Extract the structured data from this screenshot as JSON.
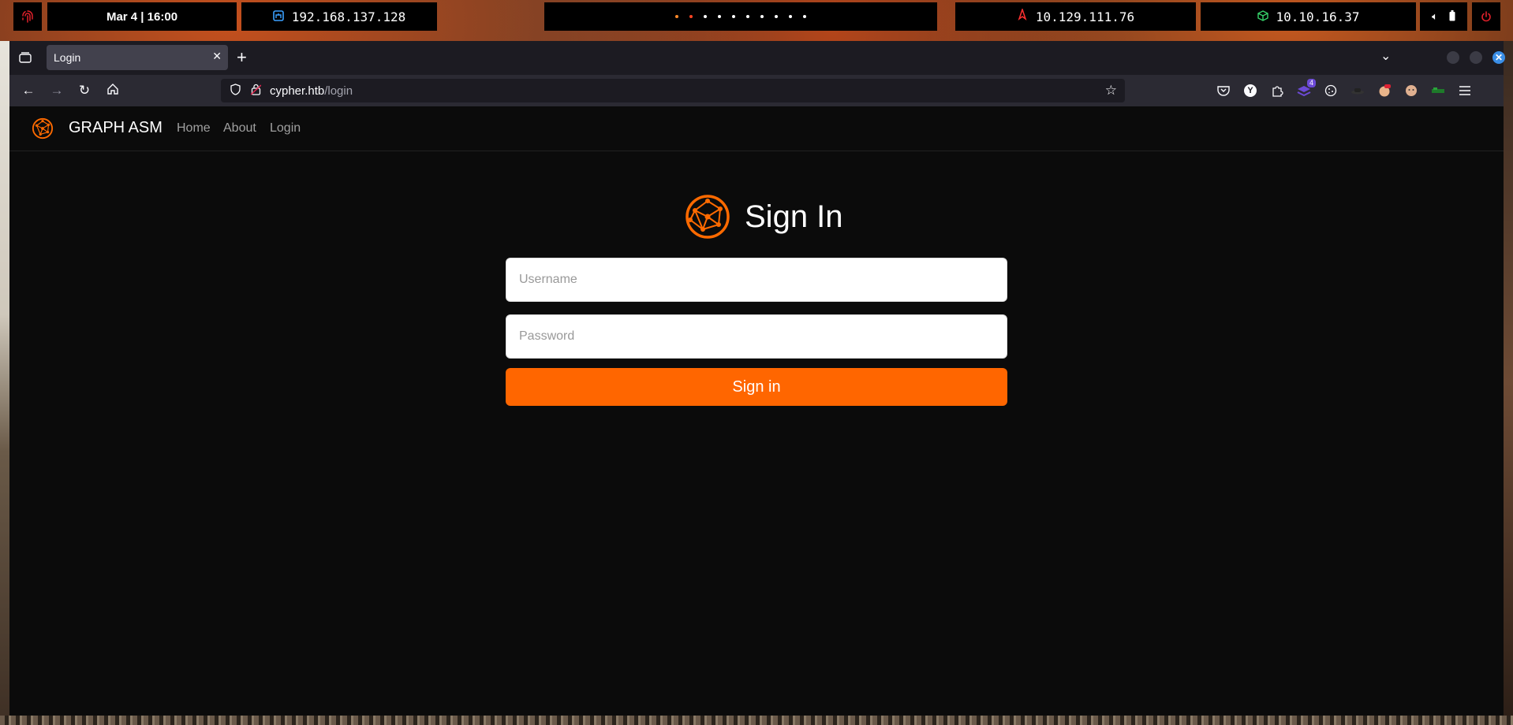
{
  "system_bar": {
    "datetime": "Mar 4 | 16:00",
    "local_ip": "192.168.137.128",
    "target_ip": "10.129.111.76",
    "vpn_ip": "10.10.16.37",
    "workspace_count": 10,
    "active_workspaces": [
      1,
      2
    ]
  },
  "browser": {
    "tab_title": "Login",
    "url_host": "cypher.htb",
    "url_path": "/login",
    "extension_badge": "4"
  },
  "site": {
    "brand": "GRAPH ASM",
    "nav_links": [
      "Home",
      "About",
      "Login"
    ],
    "accent_color": "#ff6600"
  },
  "login": {
    "title": "Sign In",
    "username_placeholder": "Username",
    "password_placeholder": "Password",
    "submit_label": "Sign in"
  }
}
